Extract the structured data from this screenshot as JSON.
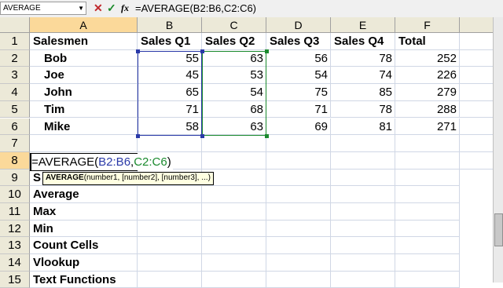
{
  "formula_bar": {
    "name_box": "AVERAGE",
    "cancel_icon": "✕",
    "enter_icon": "✓",
    "fx_label": "fx",
    "formula": "=AVERAGE(B2:B6,C2:C6)"
  },
  "columns": [
    "A",
    "B",
    "C",
    "D",
    "E",
    "F"
  ],
  "rows": [
    "1",
    "2",
    "3",
    "4",
    "5",
    "6",
    "7",
    "8",
    "9",
    "10",
    "11",
    "12",
    "13",
    "14",
    "15"
  ],
  "table": {
    "headers": [
      "Salesmen",
      "Sales Q1",
      "Sales Q2",
      "Sales Q3",
      "Sales Q4",
      "Total"
    ],
    "data": [
      [
        "Bob",
        "55",
        "63",
        "56",
        "78",
        "252"
      ],
      [
        "Joe",
        "45",
        "53",
        "54",
        "74",
        "226"
      ],
      [
        "John",
        "65",
        "54",
        "75",
        "85",
        "279"
      ],
      [
        "Tim",
        "71",
        "68",
        "71",
        "78",
        "288"
      ],
      [
        "Mike",
        "58",
        "63",
        "69",
        "81",
        "271"
      ]
    ]
  },
  "editor": {
    "prefix": "=AVERAGE(",
    "refB": "B2:B6",
    "sep": ",",
    "refC": "C2:C6",
    "suffix": ")"
  },
  "tooltip": {
    "fn": "AVERAGE",
    "args": "(number1, [number2], [number3], ...)"
  },
  "list": [
    "S",
    "Average",
    "Max",
    "Min",
    "Count Cells",
    "Vlookup",
    "Text Functions"
  ],
  "colors": {
    "rangeB": "#2b3aa8",
    "rangeC": "#1b8a2e",
    "selected_header": "#fbd99a"
  }
}
